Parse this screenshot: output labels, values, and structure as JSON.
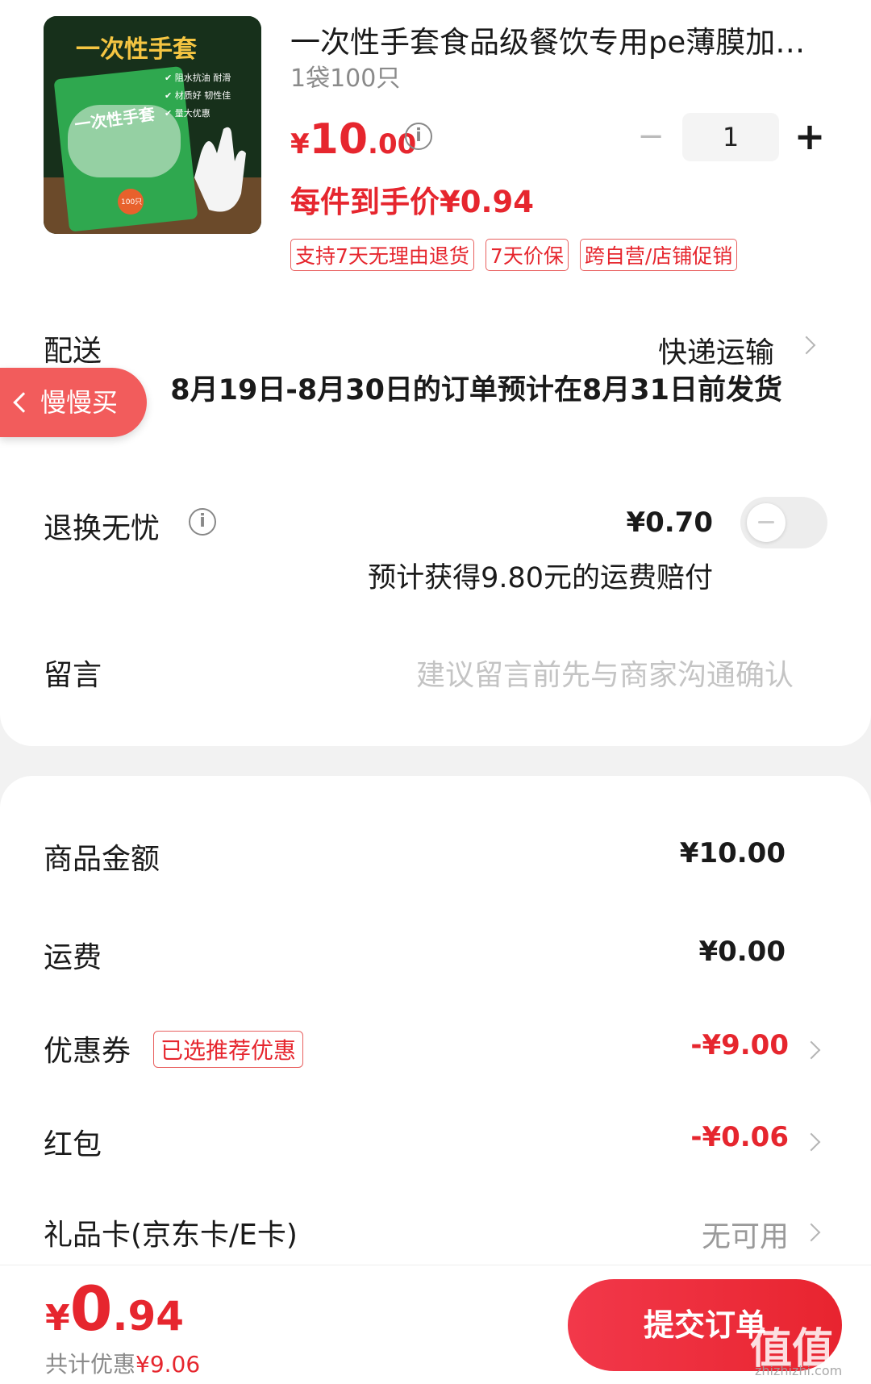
{
  "product": {
    "title": "一次性手套食品级餐饮专用pe薄膜加厚家用盒装透明塑料",
    "spec": "1袋100只",
    "price_symbol": "¥",
    "price_int": "10",
    "price_dec": ".00",
    "quantity": "1",
    "arrive_price": "每件到手价¥0.94",
    "tags": [
      "支持7天无理由退货",
      "7天价保",
      "跨自营/店铺促销"
    ],
    "image_text": {
      "banner": "一次性手套",
      "features": [
        "✔ 阻水抗油 耐滑",
        "✔ 材质好 韧性佳",
        "✔ 量大优惠"
      ],
      "pack_label": "一次性手套",
      "badge": "100只"
    }
  },
  "delivery": {
    "label": "配送",
    "method": "快递运输",
    "note": "8月19日-8月30日的订单预计在8月31日前发货"
  },
  "slow_buy": "慢慢买",
  "return_service": {
    "label": "退换无忧",
    "price": "¥0.70",
    "note": "预计获得9.80元的运费赔付",
    "enabled": false
  },
  "message": {
    "label": "留言",
    "placeholder": "建议留言前先与商家沟通确认"
  },
  "summary": {
    "goods_label": "商品金额",
    "goods_value": "¥10.00",
    "shipping_label": "运费",
    "shipping_value": "¥0.00",
    "coupon_label": "优惠券",
    "coupon_badge": "已选推荐优惠",
    "coupon_value": "-¥9.00",
    "redpacket_label": "红包",
    "redpacket_value": "-¥0.06",
    "giftcard_label": "礼品卡(京东卡/E卡)",
    "giftcard_value": "无可用"
  },
  "footer": {
    "total_symbol": "¥",
    "total_int": "0",
    "total_dec": ".94",
    "discount_label": "共计优惠",
    "discount_value": "¥9.06",
    "submit": "提交订单"
  },
  "watermark": {
    "main": "值值值",
    "sub": "zhizhizhi.com"
  },
  "colors": {
    "accent": "#e6262e",
    "slow_buy": "#f25c5c",
    "muted": "#8a8a8a"
  }
}
